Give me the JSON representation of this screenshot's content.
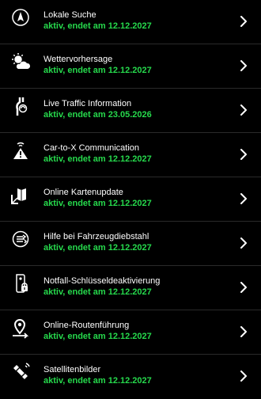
{
  "colors": {
    "active_status": "#26d94c",
    "background": "#000000",
    "text": "#ffffff"
  },
  "services": [
    {
      "icon": "compass-icon",
      "title": "Lokale Suche",
      "status": "aktiv, endet am 12.12.2027"
    },
    {
      "icon": "weather-sun-cloud-icon",
      "title": "Wettervorhersage",
      "status": "aktiv, endet am 12.12.2027"
    },
    {
      "icon": "live-traffic-icon",
      "title": "Live Traffic Information",
      "status": "aktiv, endet am 23.05.2026"
    },
    {
      "icon": "car-to-x-warning-icon",
      "title": "Car-to-X Communication",
      "status": "aktiv, endet am 12.12.2027"
    },
    {
      "icon": "map-update-icon",
      "title": "Online Kartenupdate",
      "status": "aktiv, endet am 12.12.2027"
    },
    {
      "icon": "theft-assist-icon",
      "title": "Hilfe bei Fahrzeugdiebstahl",
      "status": "aktiv, endet am 12.12.2027"
    },
    {
      "icon": "key-deactivation-icon",
      "title": "Notfall-Schlüsseldeaktivierung",
      "status": "aktiv, endet am 12.12.2027"
    },
    {
      "icon": "route-pin-icon",
      "title": "Online-Routenführung",
      "status": "aktiv, endet am 12.12.2027"
    },
    {
      "icon": "satellite-icon",
      "title": "Satellitenbilder",
      "status": "aktiv, endet am 12.12.2027"
    }
  ]
}
